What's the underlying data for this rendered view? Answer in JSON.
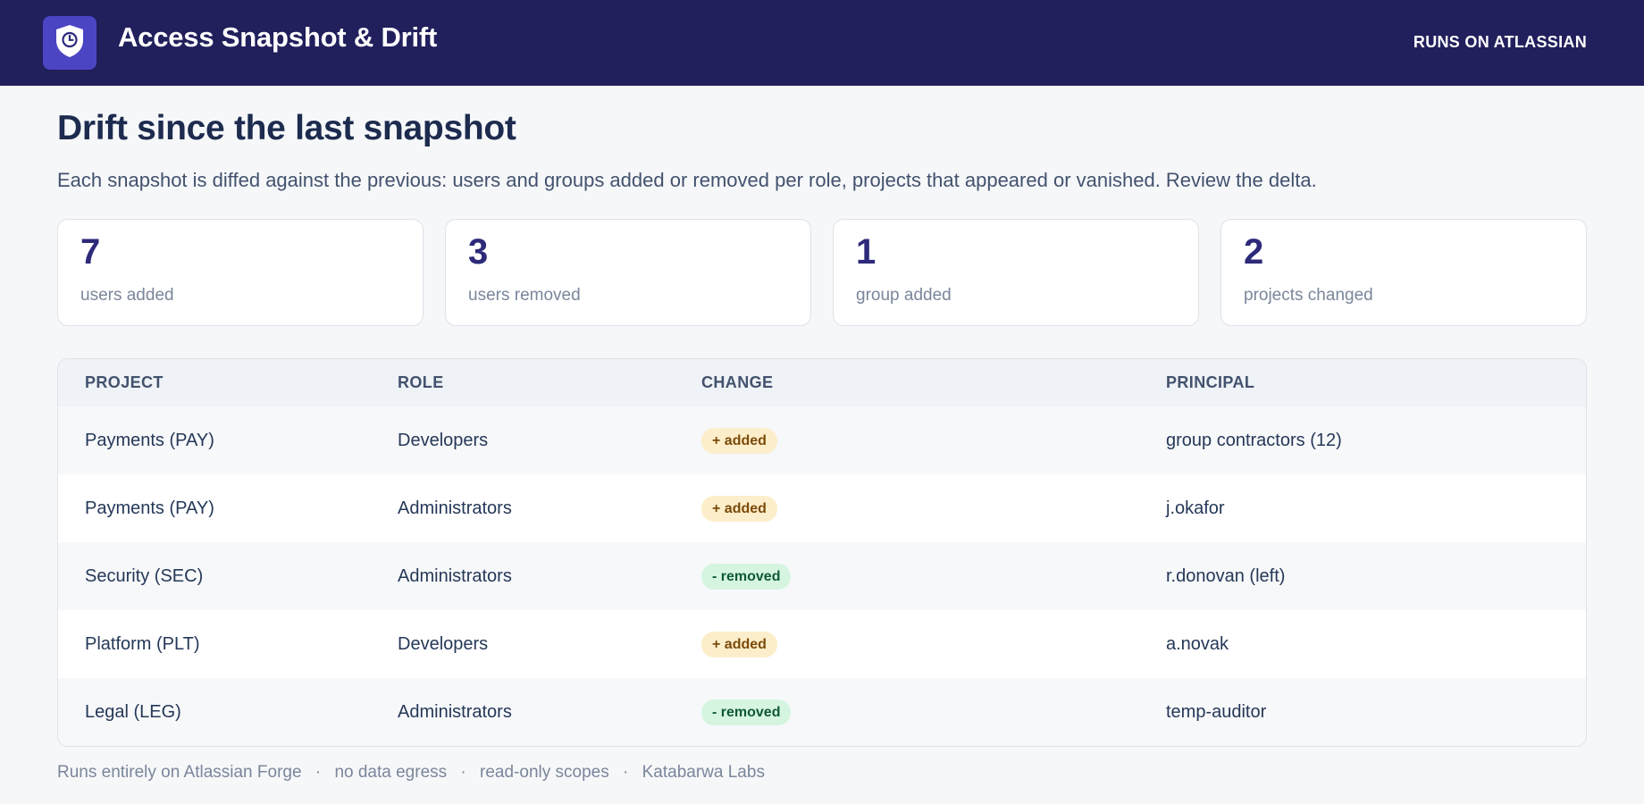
{
  "header": {
    "title": "Access Snapshot & Drift",
    "platform_badge": "RUNS ON ATLASSIAN",
    "logo_icon": "shield-clock-icon"
  },
  "page": {
    "title": "Drift since the last snapshot",
    "subtitle": "Each snapshot is diffed against the previous: users and groups added or removed per role, projects that appeared or vanished. Review the delta."
  },
  "stats": [
    {
      "value": "7",
      "label": "users added"
    },
    {
      "value": "3",
      "label": "users removed"
    },
    {
      "value": "1",
      "label": "group added"
    },
    {
      "value": "2",
      "label": "projects changed"
    }
  ],
  "table": {
    "columns": [
      "PROJECT",
      "ROLE",
      "CHANGE",
      "PRINCIPAL"
    ],
    "rows": [
      {
        "project": "Payments (PAY)",
        "role": "Developers",
        "change": "+ added",
        "change_type": "added",
        "principal": "group contractors (12)"
      },
      {
        "project": "Payments (PAY)",
        "role": "Administrators",
        "change": "+ added",
        "change_type": "added",
        "principal": "j.okafor"
      },
      {
        "project": "Security (SEC)",
        "role": "Administrators",
        "change": "- removed",
        "change_type": "removed",
        "principal": "r.donovan (left)"
      },
      {
        "project": "Platform (PLT)",
        "role": "Developers",
        "change": "+ added",
        "change_type": "added",
        "principal": "a.novak"
      },
      {
        "project": "Legal (LEG)",
        "role": "Administrators",
        "change": "- removed",
        "change_type": "removed",
        "principal": "temp-auditor"
      }
    ]
  },
  "footer": {
    "items": [
      "Runs entirely on Atlassian Forge",
      "no data egress",
      "read-only scopes",
      "Katabarwa Labs"
    ],
    "separator": "·"
  },
  "colors": {
    "header_bg": "#211f5c",
    "accent": "#4b45c4",
    "added_bg": "#fdeecb",
    "removed_bg": "#d6f5e1"
  }
}
